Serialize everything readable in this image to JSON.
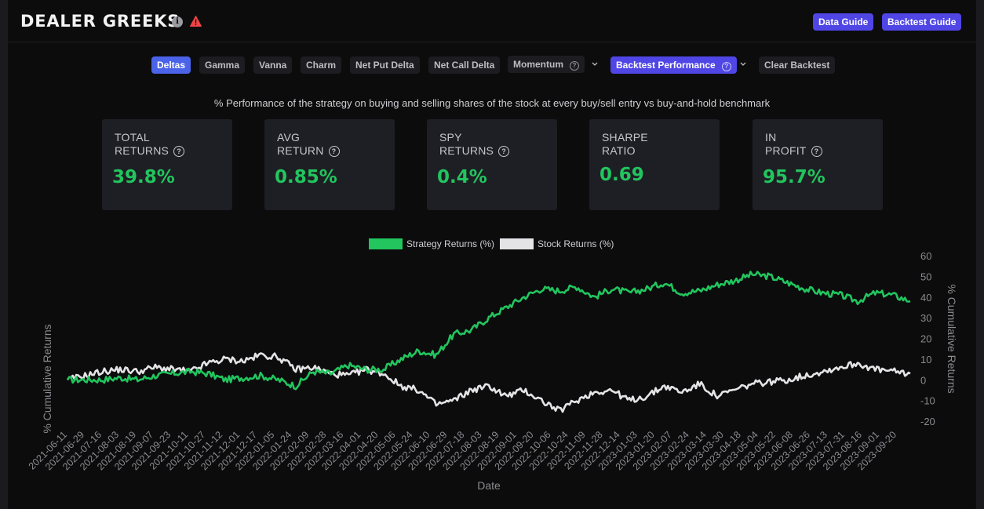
{
  "header": {
    "title": "DEALER GREEKS",
    "info_icon": "info-icon",
    "warning_icon": "warning-triangle-icon",
    "buttons": [
      {
        "label": "Data Guide"
      },
      {
        "label": "Backtest Guide"
      }
    ]
  },
  "toolbar": {
    "tabs": [
      {
        "label": "Deltas",
        "active": true
      },
      {
        "label": "Gamma",
        "active": false
      },
      {
        "label": "Vanna",
        "active": false
      },
      {
        "label": "Charm",
        "active": false
      },
      {
        "label": "Net Put Delta",
        "active": false
      },
      {
        "label": "Net Call Delta",
        "active": false
      }
    ],
    "momentum": {
      "label": "Momentum",
      "help_icon": "question-circle-icon",
      "dropdown_icon": "chevron-down-icon"
    },
    "backtest": {
      "label": "Backtest Performance",
      "help_icon": "question-circle-icon",
      "dropdown_icon": "chevron-down-icon"
    },
    "clear": {
      "label": "Clear Backtest"
    }
  },
  "subtitle": "% Performance of the strategy on buying and selling shares of the stock at every buy/sell entry vs buy-and-hold benchmark",
  "stats": [
    {
      "line1": "TOTAL",
      "line2": "RETURNS",
      "help": true,
      "value": "39.8%"
    },
    {
      "line1": "AVG",
      "line2": "RETURN",
      "help": true,
      "value": "0.85%"
    },
    {
      "line1": "SPY",
      "line2": "RETURNS",
      "help": true,
      "value": "0.4%"
    },
    {
      "line1": "SHARPE",
      "line2": "RATIO",
      "help": false,
      "value": "0.69"
    },
    {
      "line1": "IN",
      "line2": "PROFIT",
      "help": true,
      "value": "95.7%"
    }
  ],
  "colors": {
    "strategy": "#22c55e",
    "stock": "#e4e4e7",
    "accent": "#4f46e5",
    "active_tab": "#4a63e8",
    "warning": "#ef4444"
  },
  "chart_data": {
    "type": "line",
    "title": "",
    "xlabel": "Date",
    "ylabel_left": "% Cumulative Returns",
    "ylabel_right": "% Cumulative Returns",
    "ylim": [
      -20,
      60
    ],
    "yticks": [
      60,
      50,
      40,
      30,
      20,
      10,
      0,
      -10,
      -20
    ],
    "grid": false,
    "legend_position": "top-center",
    "x": [
      "2021-06-11",
      "2021-06-29",
      "2021-07-16",
      "2021-08-03",
      "2021-08-19",
      "2021-09-07",
      "2021-09-23",
      "2021-10-11",
      "2021-10-27",
      "2021-11-12",
      "2021-12-01",
      "2021-12-17",
      "2022-01-05",
      "2022-01-24",
      "2022-02-09",
      "2022-02-28",
      "2022-03-16",
      "2022-04-01",
      "2022-04-20",
      "2022-05-06",
      "2022-05-24",
      "2022-06-10",
      "2022-06-29",
      "2022-07-18",
      "2022-08-03",
      "2022-08-19",
      "2022-09-01",
      "2022-09-20",
      "2022-10-06",
      "2022-10-24",
      "2022-11-09",
      "2022-11-28",
      "2022-12-14",
      "2023-01-03",
      "2023-01-20",
      "2023-02-07",
      "2023-02-24",
      "2023-03-14",
      "2023-03-30",
      "2023-04-18",
      "2023-05-04",
      "2023-05-22",
      "2023-06-08",
      "2023-06-26",
      "2023-07-13",
      "2023-07-31",
      "2023-08-16",
      "2023-09-01",
      "2023-09-20"
    ],
    "series": [
      {
        "name": "Strategy Returns (%)",
        "values": [
          0,
          0,
          0,
          1,
          0,
          2,
          3,
          4,
          3,
          0,
          1,
          2,
          0,
          -3,
          4,
          3,
          7,
          5,
          5,
          10,
          14,
          12,
          22,
          24,
          30,
          35,
          40,
          44,
          43,
          45,
          40,
          44,
          42,
          44,
          47,
          42,
          43,
          46,
          48,
          51,
          50,
          47,
          44,
          42,
          41,
          38,
          42,
          41,
          38
        ]
      },
      {
        "name": "Stock Returns (%)",
        "values": [
          0,
          2,
          4,
          5,
          4,
          6,
          5,
          4,
          8,
          10,
          9,
          12,
          11,
          5,
          6,
          3,
          2,
          5,
          3,
          -3,
          -5,
          -12,
          -10,
          -5,
          -3,
          -8,
          -5,
          -10,
          -15,
          -10,
          -6,
          -5,
          -10,
          -8,
          -3,
          -6,
          -2,
          -8,
          -5,
          -2,
          -1,
          0,
          2,
          4,
          6,
          8,
          5,
          4,
          3
        ]
      }
    ]
  }
}
